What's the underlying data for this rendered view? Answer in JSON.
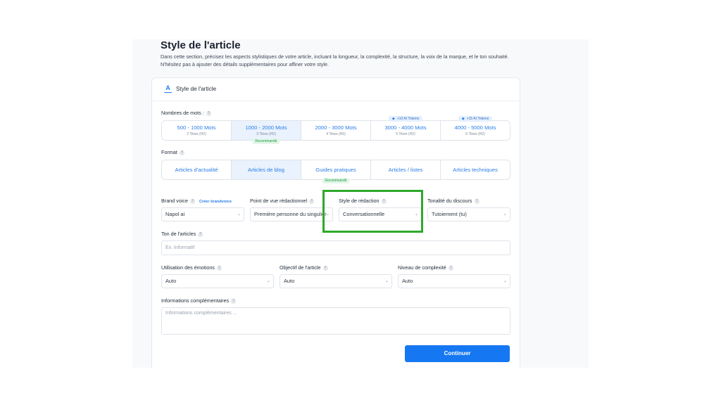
{
  "page": {
    "title": "Style de l'article",
    "description": "Dans cette section, précisez les aspects stylistiques de votre article, incluant la longueur, la complexité, la structure, la voix de la marque, et le ton souhaité. N'hésitez pas à ajouter des détails supplémentaires pour affiner votre style."
  },
  "card": {
    "title": "Style de l'article",
    "icon": "text-style-icon"
  },
  "word_count": {
    "label": "Nombres de mots :",
    "options": [
      {
        "label": "500 - 1000 Mots",
        "sub": "2 Titres (H2)",
        "badge": "",
        "selected": false
      },
      {
        "label": "1000 - 2000 Mots",
        "sub": "3 Titres (H2)",
        "badge": "Recommandé",
        "selected": true
      },
      {
        "label": "2000 - 3000 Mots",
        "sub": "4 Titres (H2)",
        "badge": "",
        "selected": false
      },
      {
        "label": "3000 - 4000 Mots",
        "sub": "5 Titres (H2)",
        "token": "+10 AI Tokens",
        "selected": false
      },
      {
        "label": "4000 - 5000 Mots",
        "sub": "6 Titres (H2)",
        "token": "+15 AI Tokens",
        "selected": false
      }
    ]
  },
  "format": {
    "label": "Format",
    "options": [
      {
        "label": "Articles d'actualité",
        "selected": false
      },
      {
        "label": "Articles de blog",
        "selected": true
      },
      {
        "label": "Guides pratiques",
        "badge": "Recommandé",
        "selected": false
      },
      {
        "label": "Articles / listes",
        "selected": false
      },
      {
        "label": "Articles techniques",
        "selected": false
      }
    ]
  },
  "brand_voice": {
    "label": "Brand voice",
    "link": "Créer brandvoice",
    "value": "Napol ai"
  },
  "point_of_view": {
    "label": "Point de vue rédactionnel",
    "value": "Première personne du singulier"
  },
  "writing_style": {
    "label": "Style de rédaction",
    "value": "Conversationnelle"
  },
  "tone_speech": {
    "label": "Tonalité du discours",
    "value": "Tutoiement (tu)"
  },
  "article_tone": {
    "label": "Ton de l'articles",
    "placeholder": "Ex. Informatif"
  },
  "emotions": {
    "label": "Utilisation des émotions",
    "value": "Auto"
  },
  "objective": {
    "label": "Objectif de l'article",
    "value": "Auto"
  },
  "complexity": {
    "label": "Niveau de complexité",
    "value": "Auto"
  },
  "extra_info": {
    "label": "Informations complémentaires",
    "placeholder": "Informations complémentaires ..."
  },
  "submit": {
    "label": "Continuer"
  },
  "colors": {
    "accent": "#1677f2",
    "highlight": "#2ea82a",
    "selected_bg": "#e9f2fd"
  }
}
